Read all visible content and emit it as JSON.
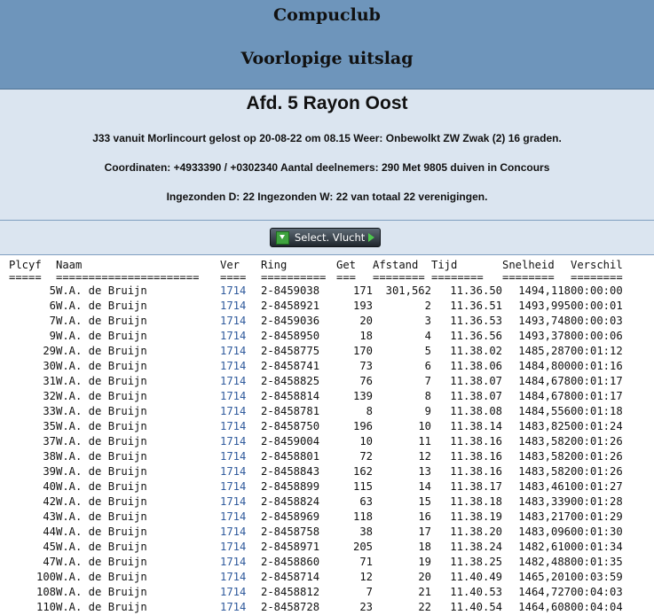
{
  "header": {
    "club": "Compuclub",
    "subtitle": "Voorlopige uitslag"
  },
  "info": {
    "afdeling": "Afd. 5 Rayon Oost",
    "line1": "J33 vanuit Morlincourt gelost op 20-08-22 om 08.15 Weer: Onbewolkt ZW Zwak (2) 16 graden.",
    "line2": "Coordinaten: +4933390 / +0302340 Aantal deelnemers: 290 Met 9805 duiven in Concours",
    "line3": "Ingezonden D: 22 Ingezonden W: 22 van totaal 22 verenigingen."
  },
  "select_button": {
    "label": "Select. Vlucht",
    "icon": "download-icon",
    "arrow": "arrow-right-icon"
  },
  "table": {
    "headers": [
      "Plcyf",
      "Naam",
      "Ver",
      "Ring",
      "Get",
      "Afstand",
      "Tijd",
      "Snelheid",
      "Verschil"
    ],
    "separators": [
      "=====",
      "======================",
      "====",
      "==========",
      "===",
      "========",
      "========",
      "========",
      "========"
    ],
    "rows": [
      [
        "5",
        "W.A. de Bruijn",
        "1714",
        "2-8459038",
        "171",
        "301,562",
        "11.36.50",
        "1494,118",
        "00:00:00"
      ],
      [
        "6",
        "W.A. de Bruijn",
        "1714",
        "2-8458921",
        "193",
        "2",
        "11.36.51",
        "1493,995",
        "00:00:01"
      ],
      [
        "7",
        "W.A. de Bruijn",
        "1714",
        "2-8459036",
        "20",
        "3",
        "11.36.53",
        "1493,748",
        "00:00:03"
      ],
      [
        "9",
        "W.A. de Bruijn",
        "1714",
        "2-8458950",
        "18",
        "4",
        "11.36.56",
        "1493,378",
        "00:00:06"
      ],
      [
        "29",
        "W.A. de Bruijn",
        "1714",
        "2-8458775",
        "170",
        "5",
        "11.38.02",
        "1485,287",
        "00:01:12"
      ],
      [
        "30",
        "W.A. de Bruijn",
        "1714",
        "2-8458741",
        "73",
        "6",
        "11.38.06",
        "1484,800",
        "00:01:16"
      ],
      [
        "31",
        "W.A. de Bruijn",
        "1714",
        "2-8458825",
        "76",
        "7",
        "11.38.07",
        "1484,678",
        "00:01:17"
      ],
      [
        "32",
        "W.A. de Bruijn",
        "1714",
        "2-8458814",
        "139",
        "8",
        "11.38.07",
        "1484,678",
        "00:01:17"
      ],
      [
        "33",
        "W.A. de Bruijn",
        "1714",
        "2-8458781",
        "8",
        "9",
        "11.38.08",
        "1484,556",
        "00:01:18"
      ],
      [
        "35",
        "W.A. de Bruijn",
        "1714",
        "2-8458750",
        "196",
        "10",
        "11.38.14",
        "1483,825",
        "00:01:24"
      ],
      [
        "37",
        "W.A. de Bruijn",
        "1714",
        "2-8459004",
        "10",
        "11",
        "11.38.16",
        "1483,582",
        "00:01:26"
      ],
      [
        "38",
        "W.A. de Bruijn",
        "1714",
        "2-8458801",
        "72",
        "12",
        "11.38.16",
        "1483,582",
        "00:01:26"
      ],
      [
        "39",
        "W.A. de Bruijn",
        "1714",
        "2-8458843",
        "162",
        "13",
        "11.38.16",
        "1483,582",
        "00:01:26"
      ],
      [
        "40",
        "W.A. de Bruijn",
        "1714",
        "2-8458899",
        "115",
        "14",
        "11.38.17",
        "1483,461",
        "00:01:27"
      ],
      [
        "42",
        "W.A. de Bruijn",
        "1714",
        "2-8458824",
        "63",
        "15",
        "11.38.18",
        "1483,339",
        "00:01:28"
      ],
      [
        "43",
        "W.A. de Bruijn",
        "1714",
        "2-8458969",
        "118",
        "16",
        "11.38.19",
        "1483,217",
        "00:01:29"
      ],
      [
        "44",
        "W.A. de Bruijn",
        "1714",
        "2-8458758",
        "38",
        "17",
        "11.38.20",
        "1483,096",
        "00:01:30"
      ],
      [
        "45",
        "W.A. de Bruijn",
        "1714",
        "2-8458971",
        "205",
        "18",
        "11.38.24",
        "1482,610",
        "00:01:34"
      ],
      [
        "47",
        "W.A. de Bruijn",
        "1714",
        "2-8458860",
        "71",
        "19",
        "11.38.25",
        "1482,488",
        "00:01:35"
      ],
      [
        "100",
        "W.A. de Bruijn",
        "1714",
        "2-8458714",
        "12",
        "20",
        "11.40.49",
        "1465,201",
        "00:03:59"
      ],
      [
        "108",
        "W.A. de Bruijn",
        "1714",
        "2-8458812",
        "7",
        "21",
        "11.40.53",
        "1464,727",
        "00:04:03"
      ],
      [
        "110",
        "W.A. de Bruijn",
        "1714",
        "2-8458728",
        "23",
        "22",
        "11.40.54",
        "1464,608",
        "00:04:04"
      ]
    ]
  }
}
